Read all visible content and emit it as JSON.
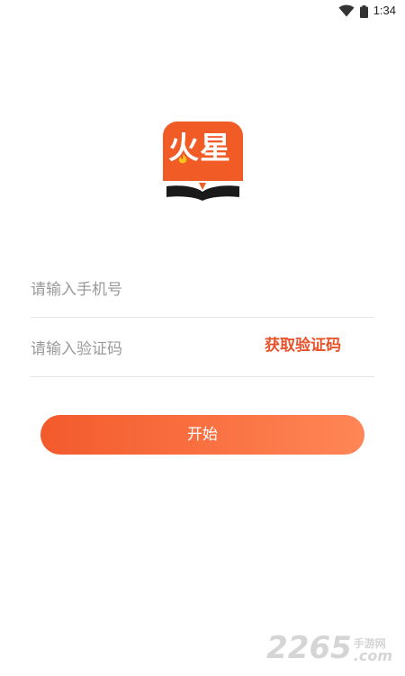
{
  "status_bar": {
    "time": "1:34",
    "wifi_icon": "wifi-icon",
    "battery_icon": "battery-icon"
  },
  "logo": {
    "text": "火星",
    "icon": "app-logo-icon",
    "brand_color": "#f15b26"
  },
  "login": {
    "phone_placeholder": "请输入手机号",
    "code_placeholder": "请输入验证码",
    "get_code_label": "获取验证码",
    "start_label": "开始",
    "accent_color": "#e8522a"
  },
  "watermark": {
    "number": "2265",
    "site_cn": "手游网",
    "site_domain": ".com"
  }
}
